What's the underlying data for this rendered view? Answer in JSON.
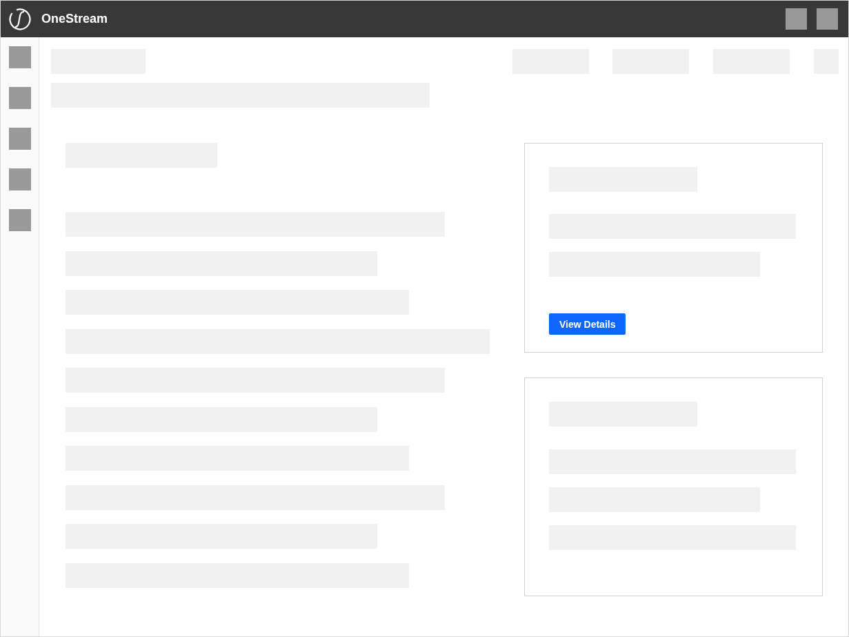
{
  "header": {
    "app_name": "OneStream"
  },
  "card": {
    "button": "View Details"
  }
}
